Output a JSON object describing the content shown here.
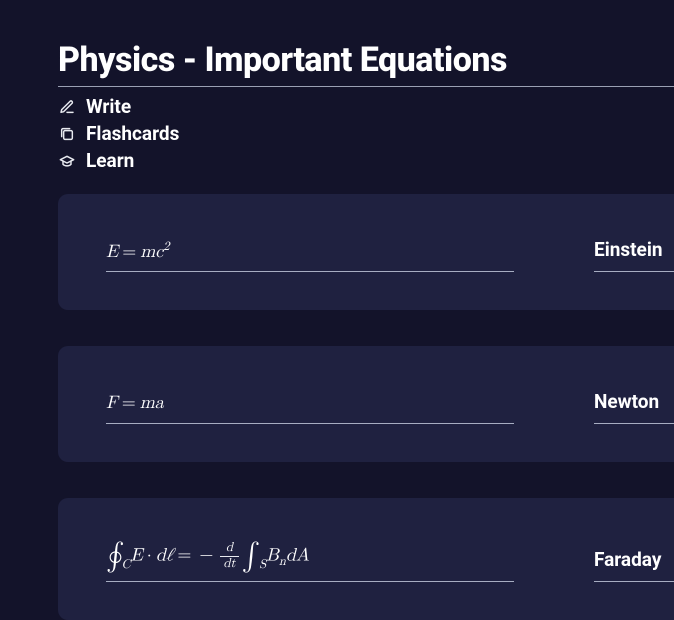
{
  "title": "Physics - Important Equations",
  "modes": {
    "write": "Write",
    "flashcards": "Flashcards",
    "learn": "Learn"
  },
  "cards": [
    {
      "term_display": "E = mc^2",
      "definition": "Einstein"
    },
    {
      "term_display": "F = ma",
      "definition": "Newton"
    },
    {
      "term_display": "∮_C E · dℓ = − d/dt ∫_S B_n dA",
      "definition": "Faraday"
    }
  ]
}
